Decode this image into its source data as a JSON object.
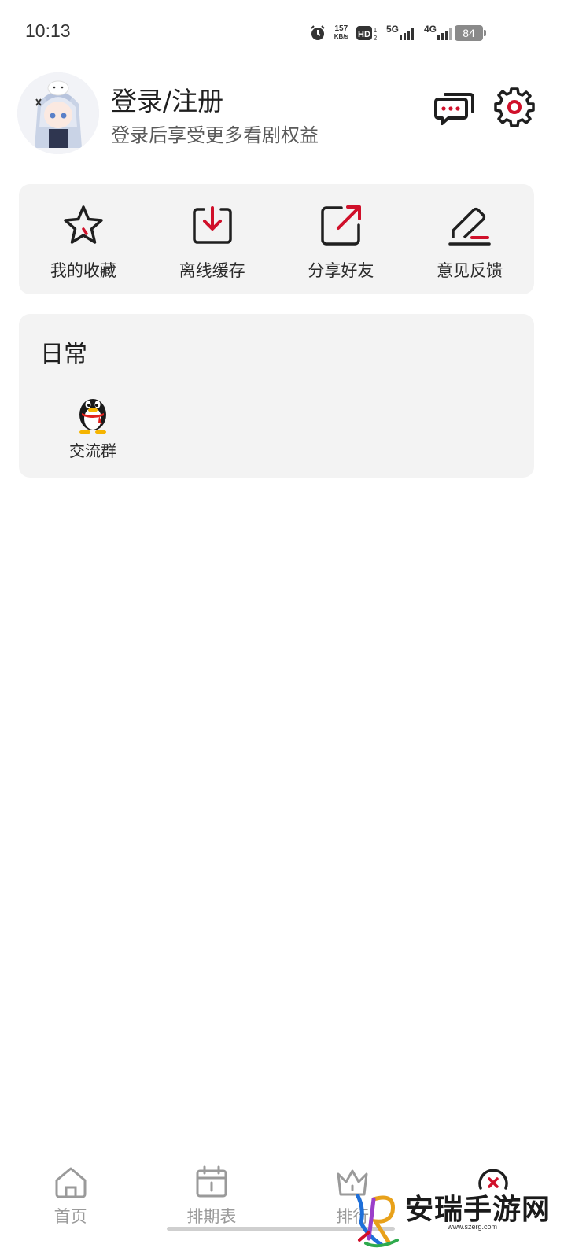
{
  "status_bar": {
    "time": "10:13",
    "net_speed_value": "157",
    "net_speed_unit": "KB/s",
    "signal_1": "5G",
    "signal_2": "4G",
    "battery": "84",
    "icons": [
      "alarm-icon",
      "hd-icon",
      "signal-5g-icon",
      "signal-4g-icon",
      "wifi-icon",
      "battery-icon"
    ]
  },
  "profile": {
    "title": "登录/注册",
    "subtitle": "登录后享受更多看剧权益",
    "icons": [
      "message-icon",
      "gear-icon"
    ]
  },
  "quick_actions": [
    {
      "label": "我的收藏",
      "icon": "star-icon"
    },
    {
      "label": "离线缓存",
      "icon": "download-icon"
    },
    {
      "label": "分享好友",
      "icon": "share-icon"
    },
    {
      "label": "意见反馈",
      "icon": "edit-icon"
    }
  ],
  "daily": {
    "title": "日常",
    "items": [
      {
        "label": "交流群",
        "icon": "qq-penguin-icon"
      }
    ]
  },
  "bottom_nav": [
    {
      "label": "首页",
      "icon": "home-icon"
    },
    {
      "label": "排期表",
      "icon": "calendar-icon"
    },
    {
      "label": "排行",
      "icon": "crown-icon"
    },
    {
      "label": "",
      "icon": "profile-icon"
    }
  ],
  "watermark": {
    "text": "安瑞手游网",
    "url": "www.szerg.com"
  },
  "colors": {
    "accent": "#d0102a",
    "card_bg": "#f3f3f3",
    "icon_dark": "#1f1f1f",
    "nav_inactive": "#9a9a9a"
  }
}
